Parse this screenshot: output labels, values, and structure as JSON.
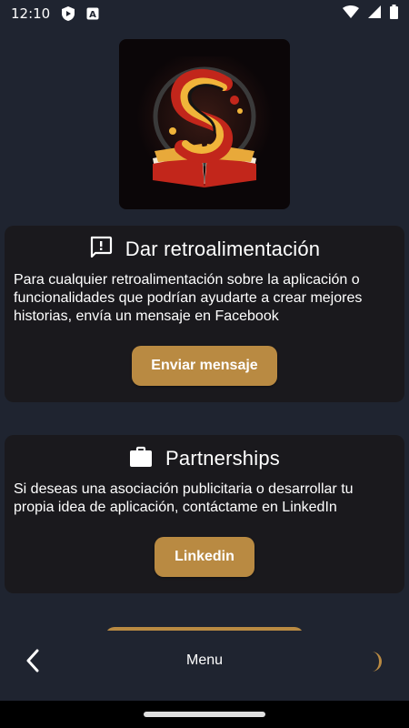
{
  "status_bar": {
    "time": "12:10",
    "icons": [
      "shield-icon",
      "a-box-icon",
      "wifi-icon",
      "signal-icon",
      "battery-icon"
    ]
  },
  "logo": {
    "name": "app-logo-s-book"
  },
  "feedback_card": {
    "icon": "feedback-message-icon",
    "title": "Dar retroalimentación",
    "body": "Para cualquier retroalimentación sobre la aplicación o funcionalidades que podrían ayudarte a crear mejores historias, envía un mensaje en Facebook",
    "button_label": "Enviar mensaje"
  },
  "partnership_card": {
    "icon": "briefcase-icon",
    "title": "Partnerships",
    "body": "Si deseas una asociación publicitaria o desarrollar tu propia idea de aplicación, contáctame en LinkedIn",
    "button_label": "Linkedin"
  },
  "bottom_bar": {
    "back_icon": "chevron-left-icon",
    "menu_label": "Menu",
    "theme_icon": "moon-icon"
  },
  "colors": {
    "background": "#1f2430",
    "card": "#1a191d",
    "accent": "#b98a42",
    "nav": "#000000"
  }
}
